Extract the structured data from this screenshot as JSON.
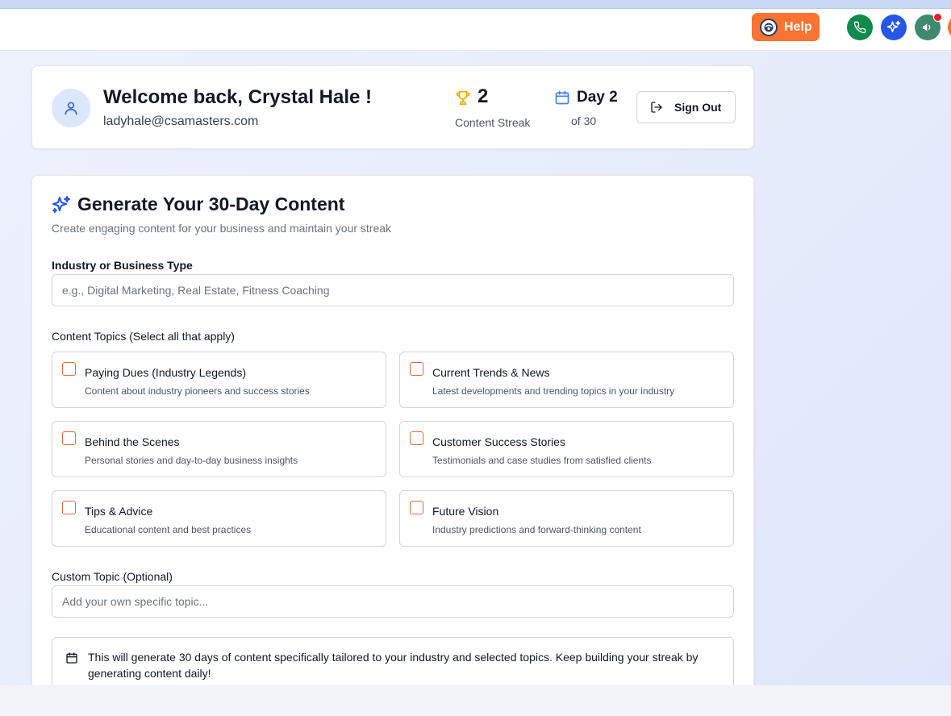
{
  "header": {
    "help_label": "Help"
  },
  "welcome": {
    "title": "Welcome back, Crystal Hale !",
    "email": "ladyhale@csamasters.com",
    "streak_value": "2",
    "streak_label": "Content Streak",
    "day_value": "Day 2",
    "day_label": "of 30",
    "signout_label": "Sign Out"
  },
  "generator": {
    "title": "Generate Your 30-Day Content",
    "subtitle": "Create engaging content for your business and maintain your streak",
    "industry_label": "Industry or Business Type",
    "industry_placeholder": "e.g., Digital Marketing, Real Estate, Fitness Coaching",
    "topics_label": "Content Topics (Select all that apply)",
    "topics": [
      {
        "title": "Paying Dues (Industry Legends)",
        "desc": "Content about industry pioneers and success stories",
        "checked": false
      },
      {
        "title": "Current Trends & News",
        "desc": "Latest developments and trending topics in your industry",
        "checked": false
      },
      {
        "title": "Behind the Scenes",
        "desc": "Personal stories and day-to-day business insights",
        "checked": false
      },
      {
        "title": "Customer Success Stories",
        "desc": "Testimonials and case studies from satisfied clients",
        "checked": false
      },
      {
        "title": "Tips & Advice",
        "desc": "Educational content and best practices",
        "checked": false
      },
      {
        "title": "Future Vision",
        "desc": "Industry predictions and forward-thinking content",
        "checked": false
      }
    ],
    "custom_label": "Custom Topic (Optional)",
    "custom_placeholder": "Add your own specific topic...",
    "info_text": "This will generate 30 days of content specifically tailored to your industry and selected topics. Keep building your streak by generating content daily!"
  },
  "colors": {
    "accent": "#f97332",
    "phone": "#0f8a4a",
    "ai": "#2457e6",
    "announce": "#3f8a6c",
    "streak_icon": "#eab308",
    "calendar_icon": "#3b82f6",
    "checkbox_border": "#e2693b"
  },
  "icons": {
    "help": "help-logo-icon",
    "phone": "phone-icon",
    "ai": "sparkles-icon",
    "announce": "megaphone-icon",
    "user": "user-icon",
    "trophy": "trophy-icon",
    "calendar": "calendar-icon",
    "signout": "log-out-icon"
  }
}
